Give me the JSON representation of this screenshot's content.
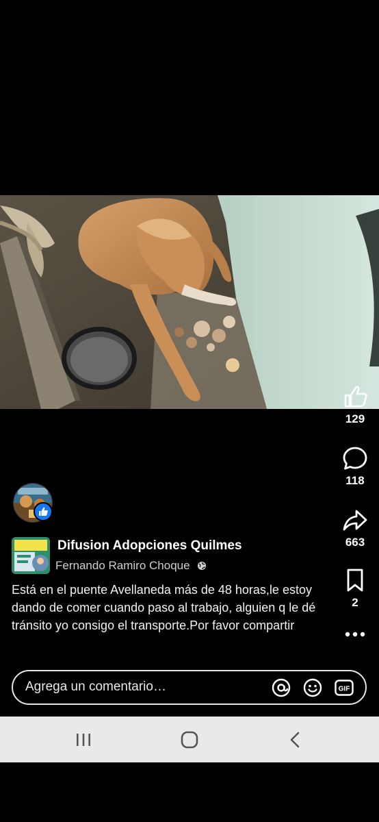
{
  "reel": {
    "actions": {
      "like_count": "129",
      "comment_count": "118",
      "share_count": "663",
      "save_count": "2"
    },
    "group_name": "Difusion Adopciones Quilmes",
    "author_name": "Fernando Ramiro Choque",
    "caption": "Está en el puente Avellaneda más de 48 horas,le estoy dando de comer cuando paso al trabajo, alguien q le dé tránsito yo consigo el transporte.Por favor compartir"
  },
  "comment": {
    "placeholder": "Agrega un comentario…",
    "gif_label": "GIF"
  },
  "icons": {
    "like": "thumbs-up-icon",
    "comment": "speech-bubble-icon",
    "share": "share-arrow-icon",
    "save": "bookmark-icon",
    "more": "more-dots-icon",
    "mention": "at-sign-icon",
    "emoji": "emoji-icon",
    "gif": "gif-icon",
    "privacy": "globe-icon",
    "badge": "facebook-like-badge-icon",
    "nav_recents": "recents-icon",
    "nav_home": "home-icon",
    "nav_back": "back-icon"
  },
  "colors": {
    "background": "#000000",
    "accent": "#1877f2",
    "text": "#ffffff",
    "navbar": "#e9e9e9"
  }
}
